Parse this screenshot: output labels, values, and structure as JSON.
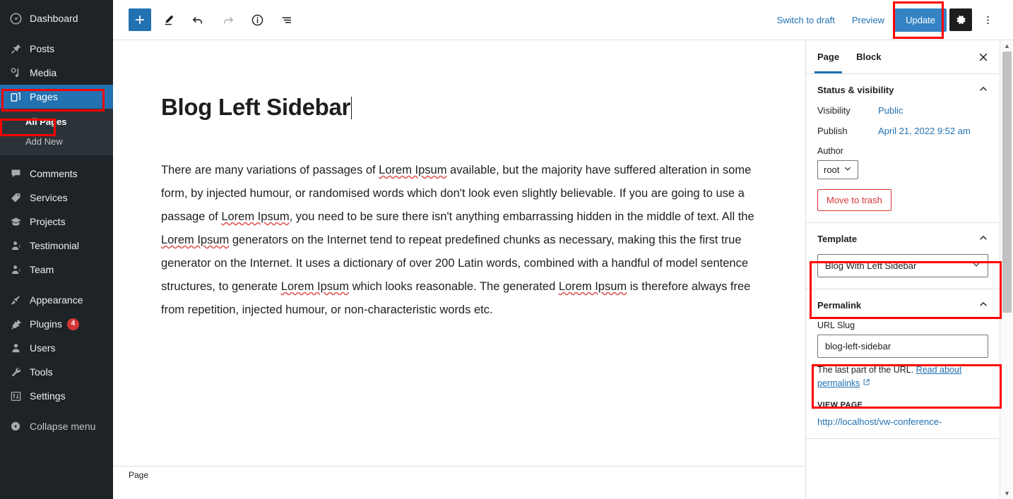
{
  "admin_menu": {
    "items": [
      {
        "label": "Dashboard",
        "icon": "dashboard-icon",
        "name": "dashboard"
      },
      {
        "label": "Posts",
        "icon": "pin-icon",
        "name": "posts"
      },
      {
        "label": "Media",
        "icon": "media-icon",
        "name": "media"
      },
      {
        "label": "Pages",
        "icon": "pages-icon",
        "name": "pages",
        "current": true
      },
      {
        "label": "Comments",
        "icon": "comments-icon",
        "name": "comments"
      },
      {
        "label": "Services",
        "icon": "tag-icon",
        "name": "services"
      },
      {
        "label": "Projects",
        "icon": "projects-icon",
        "name": "projects"
      },
      {
        "label": "Testimonial",
        "icon": "person-icon",
        "name": "testimonial"
      },
      {
        "label": "Team",
        "icon": "team-icon",
        "name": "team"
      },
      {
        "label": "Appearance",
        "icon": "brush-icon",
        "name": "appearance"
      },
      {
        "label": "Plugins",
        "icon": "plugin-icon",
        "name": "plugins",
        "badge": "4"
      },
      {
        "label": "Users",
        "icon": "users-icon",
        "name": "users"
      },
      {
        "label": "Tools",
        "icon": "wrench-icon",
        "name": "tools"
      },
      {
        "label": "Settings",
        "icon": "settings-icon",
        "name": "settings"
      },
      {
        "label": "Collapse menu",
        "icon": "collapse-icon",
        "name": "collapse-menu"
      }
    ],
    "pages_submenu": [
      {
        "label": "All Pages",
        "current": true
      },
      {
        "label": "Add New",
        "current": false
      }
    ]
  },
  "toolbar": {
    "add_block_icon": "plus-icon",
    "tools_icon": "pencil-icon",
    "undo_icon": "undo-arrow-icon",
    "redo_icon": "redo-arrow-icon",
    "details_icon": "info-icon",
    "list_view_icon": "list-view-icon",
    "switch_to_draft": "Switch to draft",
    "preview": "Preview",
    "update": "Update",
    "settings_icon": "gear-icon",
    "options_icon": "three-dots-vertical-icon"
  },
  "editor": {
    "title": "Blog Left Sidebar",
    "body_paragraph": "There are many variations of passages of Lorem Ipsum available, but the majority have suffered alteration in some form, by injected humour, or randomised words which don't look even slightly believable. If you are going to use a passage of Lorem Ipsum, you need to be sure there isn't anything embarrassing hidden in the middle of text. All the Lorem Ipsum generators on the Internet tend to repeat predefined chunks as necessary, making this the first true generator on the Internet. It uses a dictionary of over 200 Latin words, combined with a handful of model sentence structures, to generate Lorem Ipsum which looks reasonable. The generated Lorem Ipsum is therefore always free from repetition, injected humour, or non-characteristic words etc.",
    "breadcrumb": "Page"
  },
  "settings_panel": {
    "tabs": [
      {
        "label": "Page",
        "active": true
      },
      {
        "label": "Block",
        "active": false
      }
    ],
    "close_icon": "close-icon",
    "status_visibility": {
      "title": "Status & visibility",
      "collapse_icon": "chevron-up-icon",
      "visibility_label": "Visibility",
      "visibility_value": "Public",
      "publish_label": "Publish",
      "publish_value": "April 21, 2022 9:52 am",
      "author_label": "Author",
      "author_value": "root",
      "move_to_trash": "Move to trash"
    },
    "template": {
      "title": "Template",
      "collapse_icon": "chevron-up-icon",
      "value": "Blog With Left Sidebar",
      "dropdown_icon": "chevron-down-icon"
    },
    "permalink": {
      "title": "Permalink",
      "collapse_icon": "chevron-up-icon",
      "slug_label": "URL Slug",
      "slug_value": "blog-left-sidebar",
      "help_prefix": "The last part of the URL.",
      "help_link": "Read about permalinks",
      "external_icon": "external-link-icon",
      "view_page_label": "VIEW PAGE",
      "view_page_url": "http://localhost/vw-conference-"
    }
  },
  "scrollbar": {
    "up_icon": "triangle-up-icon",
    "down_icon": "triangle-down-icon"
  },
  "colors": {
    "admin_bg": "#1d2327",
    "submenu_bg": "#2c3338",
    "accent_blue": "#2271b1",
    "button_blue": "#3582c4",
    "annotation_red": "#fe0000",
    "danger_red": "#d63638"
  }
}
